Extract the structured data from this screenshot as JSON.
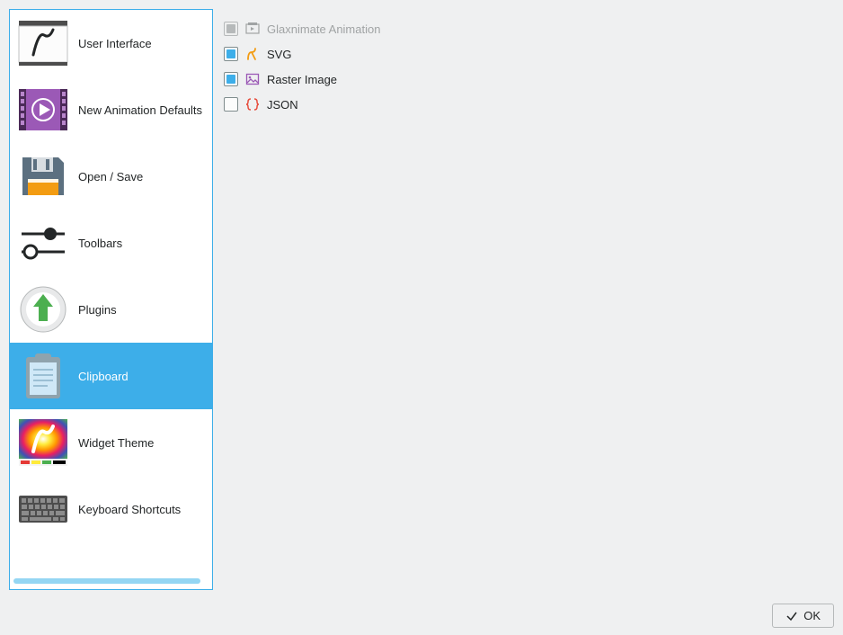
{
  "sidebar": {
    "items": [
      {
        "label": "User Interface",
        "id": "user-interface"
      },
      {
        "label": "New Animation Defaults",
        "id": "new-animation-defaults"
      },
      {
        "label": "Open / Save",
        "id": "open-save"
      },
      {
        "label": "Toolbars",
        "id": "toolbars"
      },
      {
        "label": "Plugins",
        "id": "plugins"
      },
      {
        "label": "Clipboard",
        "id": "clipboard"
      },
      {
        "label": "Widget Theme",
        "id": "widget-theme"
      },
      {
        "label": "Keyboard Shortcuts",
        "id": "keyboard-shortcuts"
      }
    ],
    "selected_index": 5
  },
  "content": {
    "options": [
      {
        "label": "Glaxnimate Animation",
        "checked": true,
        "disabled": true,
        "icon": "glaxnimate-icon"
      },
      {
        "label": "SVG",
        "checked": true,
        "disabled": false,
        "icon": "svg-icon"
      },
      {
        "label": "Raster Image",
        "checked": true,
        "disabled": false,
        "icon": "image-icon"
      },
      {
        "label": "JSON",
        "checked": false,
        "disabled": false,
        "icon": "json-icon"
      }
    ]
  },
  "footer": {
    "ok_label": "OK"
  }
}
